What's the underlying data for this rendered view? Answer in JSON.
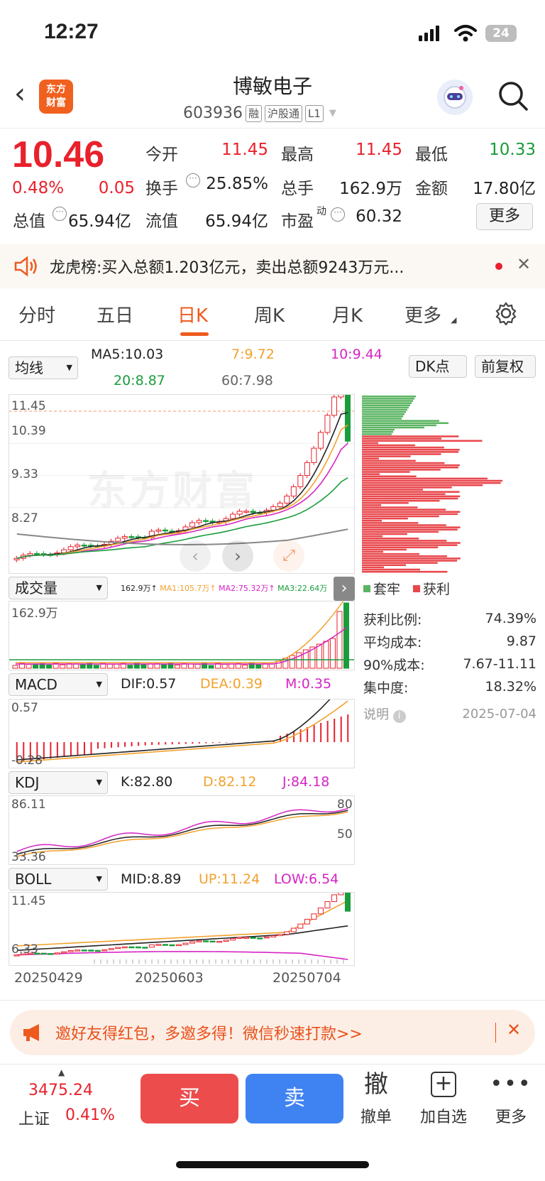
{
  "status_bar": {
    "time": "12:27",
    "battery": "24"
  },
  "header": {
    "logo_line1": "东方",
    "logo_line2": "财富",
    "name": "博敏电子",
    "code": "603936",
    "tags": [
      "融",
      "沪股通",
      "L1"
    ]
  },
  "quote": {
    "price": "10.46",
    "change_pct": "0.48%",
    "change": "0.05",
    "open_label": "今开",
    "open": "11.45",
    "high_label": "最高",
    "high": "11.45",
    "low_label": "最低",
    "low": "10.33",
    "turnover_label": "换手",
    "turnover": "25.85%",
    "volume_label": "总手",
    "volume": "162.9万",
    "amount_label": "金额",
    "amount": "17.80亿",
    "mcap_label": "总值",
    "mcap": "65.94亿",
    "float_label": "流值",
    "float": "65.94亿",
    "pe_label": "市盈",
    "pe_sup": "动",
    "pe": "60.32",
    "more": "更多"
  },
  "news": {
    "label": "龙虎榜:",
    "text": "买入总额1.203亿元，卖出总额9243万元..."
  },
  "tabs": [
    "分时",
    "五日",
    "日K",
    "周K",
    "月K",
    "更多"
  ],
  "chart": {
    "ma_select": "均线",
    "ma5": "MA5:10.03",
    "ma7": "7:9.72",
    "ma10": "10:9.44",
    "ma20": "20:8.87",
    "ma60": "60:7.98",
    "dk": "DK点",
    "adjust": "前复权",
    "price_ticks": [
      "11.45",
      "10.39",
      "9.33",
      "8.27"
    ],
    "watermark": "东方财富",
    "vol_select": "成交量",
    "vol_vals": "162.9万↑",
    "vol_ma1": "MA1:105.7万↑",
    "vol_ma2": "MA2:75.32万↑",
    "vol_ma3": "MA3:22.64万",
    "vol_top": "162.9万",
    "macd_select": "MACD",
    "dif": "DIF:0.57",
    "dea": "DEA:0.39",
    "m": "M:0.35",
    "macd_top": "0.57",
    "macd_bottom": "-0.28",
    "kdj_select": "KDJ",
    "k": "K:82.80",
    "d": "D:82.12",
    "j": "J:84.18",
    "kdj_top": "86.11",
    "kdj_bottom": "33.36",
    "kdj_80": "80",
    "kdj_50": "50",
    "boll_select": "BOLL",
    "mid": "MID:8.89",
    "up": "UP:11.24",
    "low": "LOW:6.54",
    "boll_top": "11.45",
    "boll_bottom": "6.33",
    "dates": [
      "20250429",
      "20250603",
      "20250704"
    ]
  },
  "chip_panel": {
    "legend_trapped": "套牢",
    "legend_profit": "获利",
    "rows": [
      {
        "label": "获利比例:",
        "value": "74.39%"
      },
      {
        "label": "平均成本:",
        "value": "9.87"
      },
      {
        "label": "90%成本:",
        "value": "7.67-11.11"
      },
      {
        "label": "集中度:",
        "value": "18.32%"
      }
    ],
    "note_label": "说明",
    "date": "2025-07-04"
  },
  "banner": {
    "text": "邀好友得红包，多邀多得！微信秒速打款>>"
  },
  "bottom": {
    "index_value": "3475.24",
    "index_name": "上证",
    "index_change": "0.41%",
    "buy": "买",
    "sell": "卖",
    "cancel_glyph": "撤",
    "cancel": "撤单",
    "watchlist": "加自选",
    "more": "更多"
  },
  "colors": {
    "up": "#e8212c",
    "down": "#1a9c3c",
    "accent": "#ee5a1e",
    "buy_btn": "#ec4c4c",
    "sell_btn": "#3f82f2"
  }
}
